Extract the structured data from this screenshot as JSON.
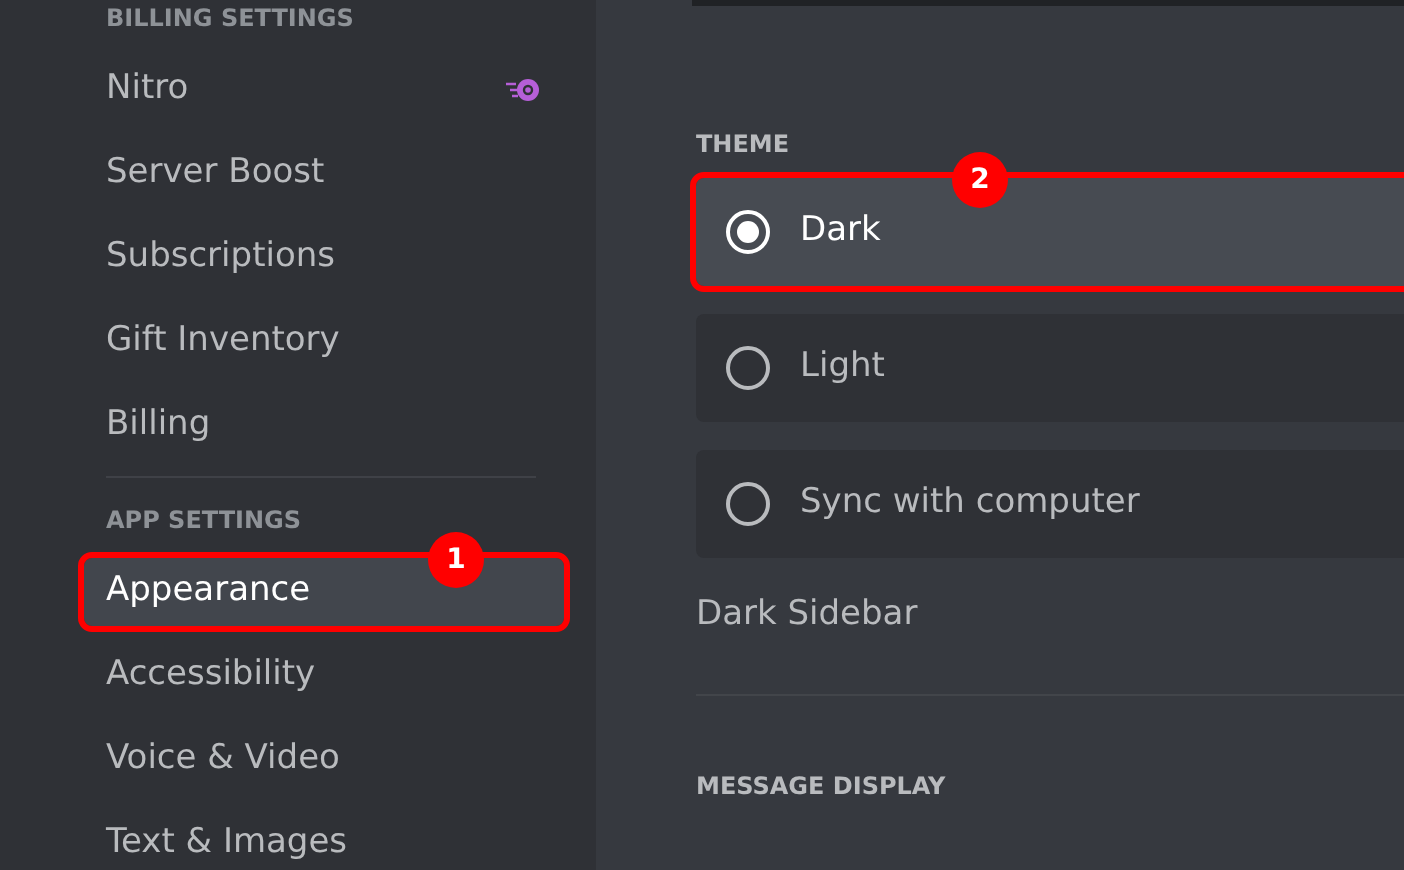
{
  "sidebar": {
    "sections": [
      {
        "heading": "BILLING SETTINGS",
        "items": [
          {
            "label": "Nitro",
            "selected": false,
            "kind": "iconed"
          },
          {
            "label": "Server Boost",
            "selected": false,
            "kind": "plain"
          },
          {
            "label": "Subscriptions",
            "selected": false,
            "kind": "plain"
          },
          {
            "label": "Gift Inventory",
            "selected": false,
            "kind": "plain"
          },
          {
            "label": "Billing",
            "selected": false,
            "kind": "plain"
          }
        ]
      },
      {
        "heading": "APP SETTINGS",
        "items": [
          {
            "label": "Appearance",
            "selected": true,
            "kind": "plain",
            "callout": "1"
          },
          {
            "label": "Accessibility",
            "selected": false,
            "kind": "plain"
          },
          {
            "label": "Voice & Video",
            "selected": false,
            "kind": "plain"
          },
          {
            "label": "Text & Images",
            "selected": false,
            "kind": "plain"
          }
        ]
      }
    ]
  },
  "theme": {
    "heading": "THEME",
    "options": [
      {
        "label": "Dark",
        "selected": true,
        "callout": "2"
      },
      {
        "label": "Light",
        "selected": false
      },
      {
        "label": "Sync with computer",
        "selected": false
      }
    ]
  },
  "dark_sidebar": {
    "label": "Dark Sidebar"
  },
  "message_display": {
    "heading": "MESSAGE DISPLAY"
  }
}
